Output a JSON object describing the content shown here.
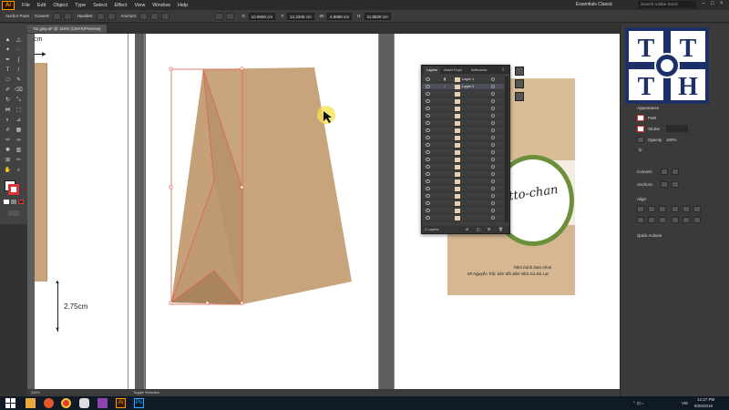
{
  "app": {
    "logo": "Ai",
    "menu": [
      "File",
      "Edit",
      "Object",
      "Type",
      "Select",
      "Effect",
      "View",
      "Window",
      "Help"
    ],
    "workspace": "Essentials Classic",
    "search_placeholder": "Search Adobe Stock"
  },
  "control_bar": {
    "label": "Anchor Point",
    "convert": "Convert:",
    "handles": "Handles:",
    "anchors": "Anchors:",
    "x_value": "10.9808 cm",
    "y_value": "24.2206 cm",
    "w_value": "4.9886 cm",
    "h_value": "11.8829 cm"
  },
  "document": {
    "tab_title": "Tui giay.ai* @ 110% (CMYK/Preview)",
    "zoom": "110%",
    "status": "Toggle Selection"
  },
  "canvas": {
    "measure_top": "cm",
    "measure_side": "2.75cm"
  },
  "product_label": {
    "brand": "itto-chan",
    "line1": "Tiệm bánh lotto-chan",
    "line2": "59 Nguyễn Trãi, bên đối diện Nhà Ga Đà Lạt"
  },
  "layers_panel": {
    "tabs": [
      "Layers",
      "Asset Expo",
      "Artboards"
    ],
    "layer1": "Layer 1",
    "layer2": "Layer 2",
    "count": "2 Layers"
  },
  "right_panel": {
    "logo_letters": [
      "T",
      "T",
      "T",
      "H"
    ],
    "appearance": "Appearance",
    "path": "Path",
    "stroke": "Stroke",
    "opacity": "Opacity",
    "opacity_value": "100%",
    "fx": "fx",
    "convert": "Convert:",
    "anchors": "Anchors:",
    "align": "Align",
    "quick_actions": "Quick Actions"
  },
  "taskbar": {
    "time": "12:47 PM",
    "date": "8/26/2019",
    "lang": "VIE"
  },
  "colors": {
    "bag": "#c8a47c",
    "bag_shadow": "#b38f69",
    "selection": "#e0604d",
    "label_bg": "#f3ece0",
    "label_green": "#6b8f3a",
    "accent": "#ff9a00"
  }
}
